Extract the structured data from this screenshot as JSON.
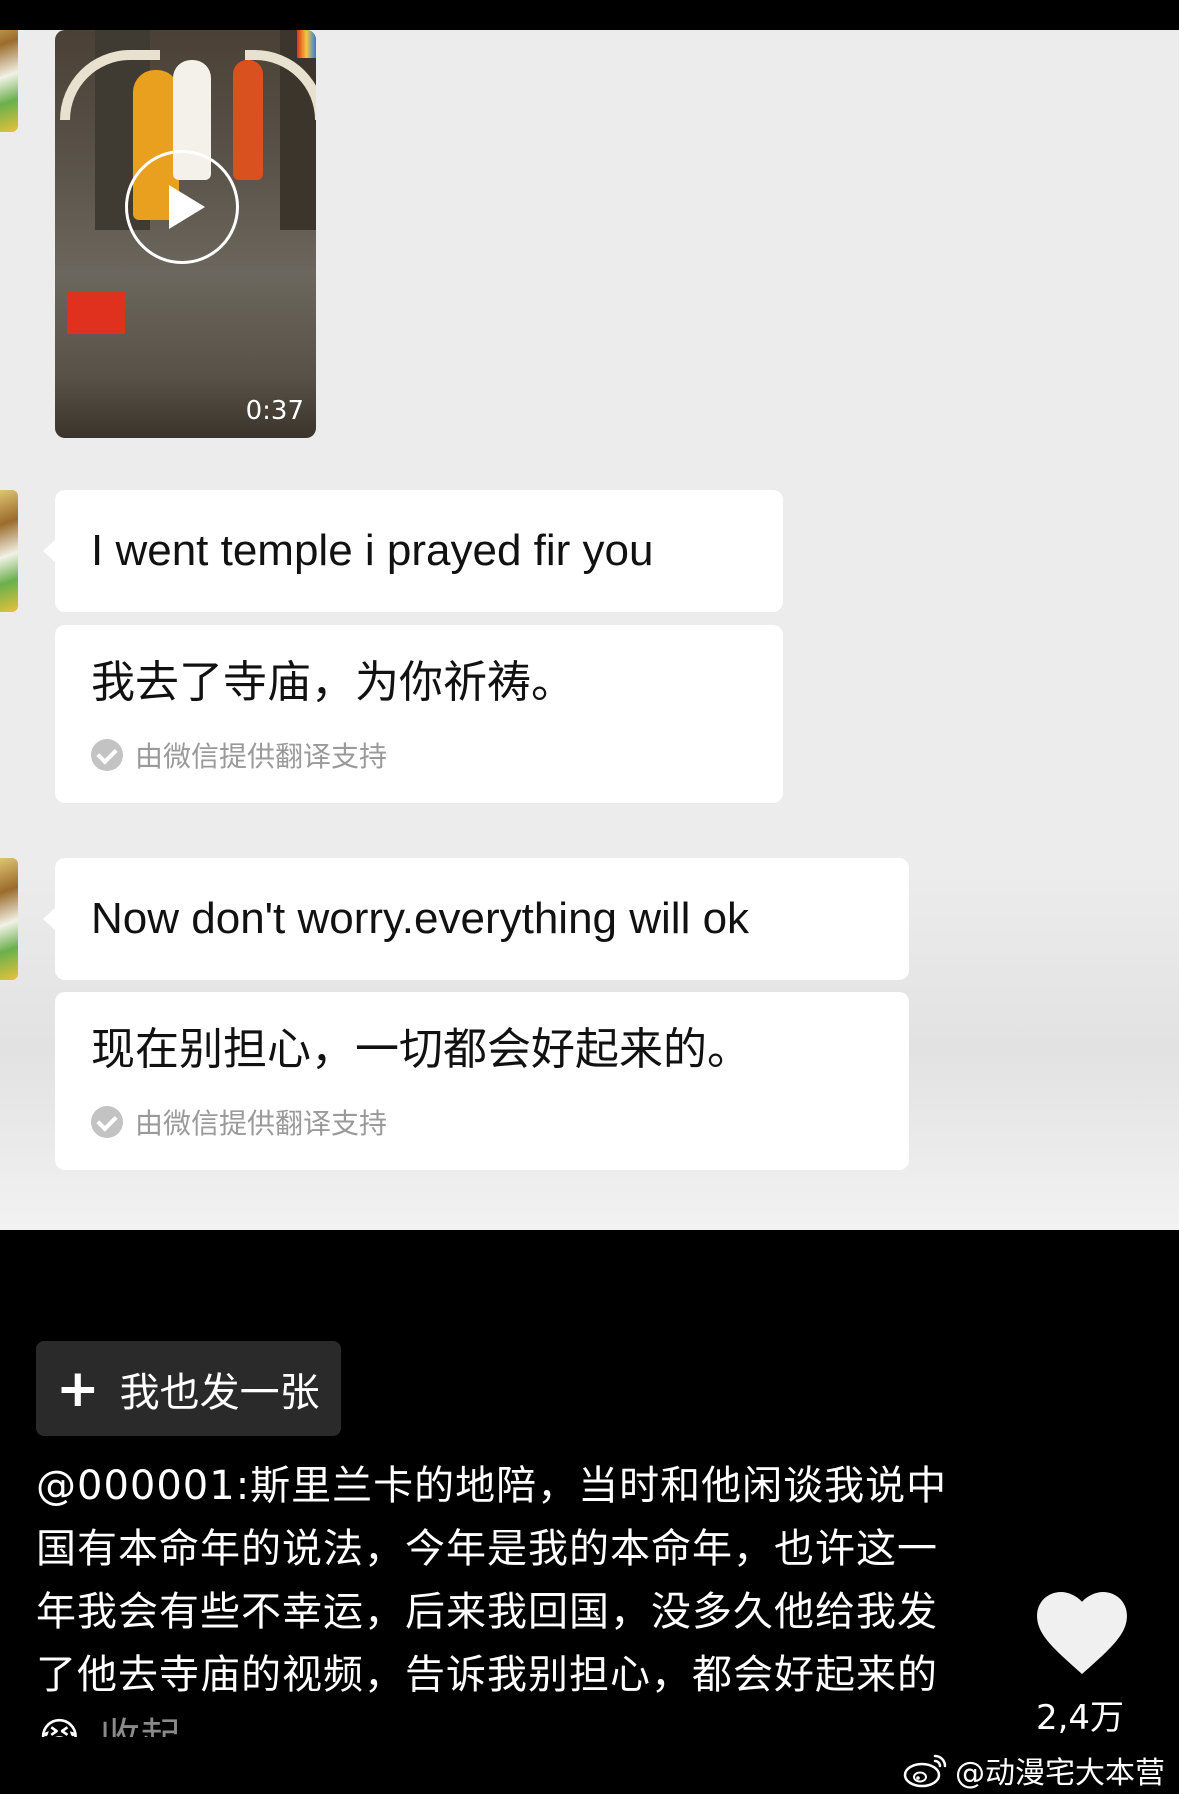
{
  "video": {
    "duration": "0:37"
  },
  "messages": [
    {
      "text": "I went temple i prayed fir you",
      "translation": "我去了寺庙，为你祈祷。",
      "translation_note": "由微信提供翻译支持"
    },
    {
      "text": "Now don't worry.everything will ok",
      "translation": "现在别担心，一切都会好起来的。",
      "translation_note": "由微信提供翻译支持"
    }
  ],
  "post_button": {
    "label": "我也发一张"
  },
  "caption": {
    "text": "@000001:斯里兰卡的地陪，当时和他闲谈我说中国有本命年的说法，今年是我的本命年，也许这一年我会有些不幸运，后来我回国，没多久他给我发了他去寺庙的视频，告诉我别担心，都会好起来的😭",
    "expand_label": "收起"
  },
  "like": {
    "count": "2,4万"
  },
  "watermark": {
    "text": "@动漫宅大本营"
  },
  "colors": {
    "chat_background": "#ececec",
    "bubble": "#ffffff",
    "page_background": "#000000"
  }
}
